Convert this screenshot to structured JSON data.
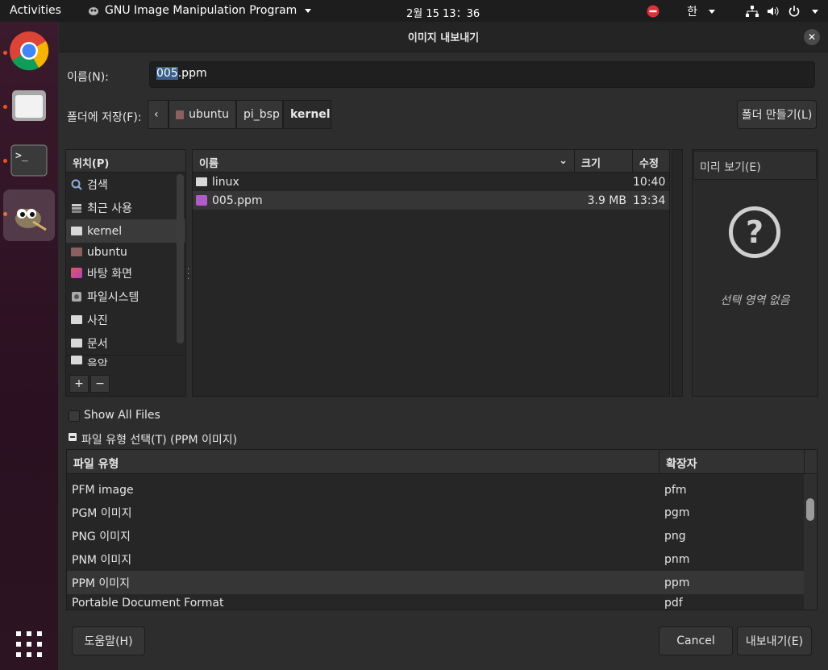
{
  "topbar": {
    "activities": "Activities",
    "app_name": "GNU Image Manipulation Program",
    "clock": "2월 15  13：36",
    "input_method": "한"
  },
  "dialog": {
    "title": "이미지 내보내기",
    "name_label": "이름(N):",
    "name_value_selected": "005",
    "name_value_ext": ".ppm",
    "save_in_label": "폴더에 저장(F):",
    "breadcrumbs": [
      "ubuntu",
      "pi_bsp",
      "kernel"
    ],
    "create_folder": "폴더 만들기(L)",
    "places_header": "위치(P)",
    "places": [
      "검색",
      "최근 사용",
      "kernel",
      "ubuntu",
      "바탕 화면",
      "파일시스템",
      "사진",
      "문서",
      "음악"
    ],
    "files_columns": {
      "name": "이름",
      "size": "크기",
      "modified": "수정"
    },
    "files": [
      {
        "name": "linux",
        "size": "",
        "modified": "10:40"
      },
      {
        "name": "005.ppm",
        "size": "3.9 MB",
        "modified": "13:34"
      }
    ],
    "preview_label": "미리 보기(E)",
    "no_selection": "선택 영역 없음",
    "show_all_files": "Show All Files",
    "file_type_toggle": "파일 유형 선택(T) (PPM 이미지)",
    "types_columns": {
      "type": "파일 유형",
      "ext": "확장자"
    },
    "types": [
      {
        "name": "PFM image",
        "ext": "pfm"
      },
      {
        "name": "PGM 이미지",
        "ext": "pgm"
      },
      {
        "name": "PNG 이미지",
        "ext": "png"
      },
      {
        "name": "PNM 이미지",
        "ext": "pnm"
      },
      {
        "name": "PPM 이미지",
        "ext": "ppm"
      },
      {
        "name": "Portable Document Format",
        "ext": "pdf"
      }
    ],
    "help_button": "도움말(H)",
    "cancel_button": "Cancel",
    "export_button": "내보내기(E)"
  }
}
